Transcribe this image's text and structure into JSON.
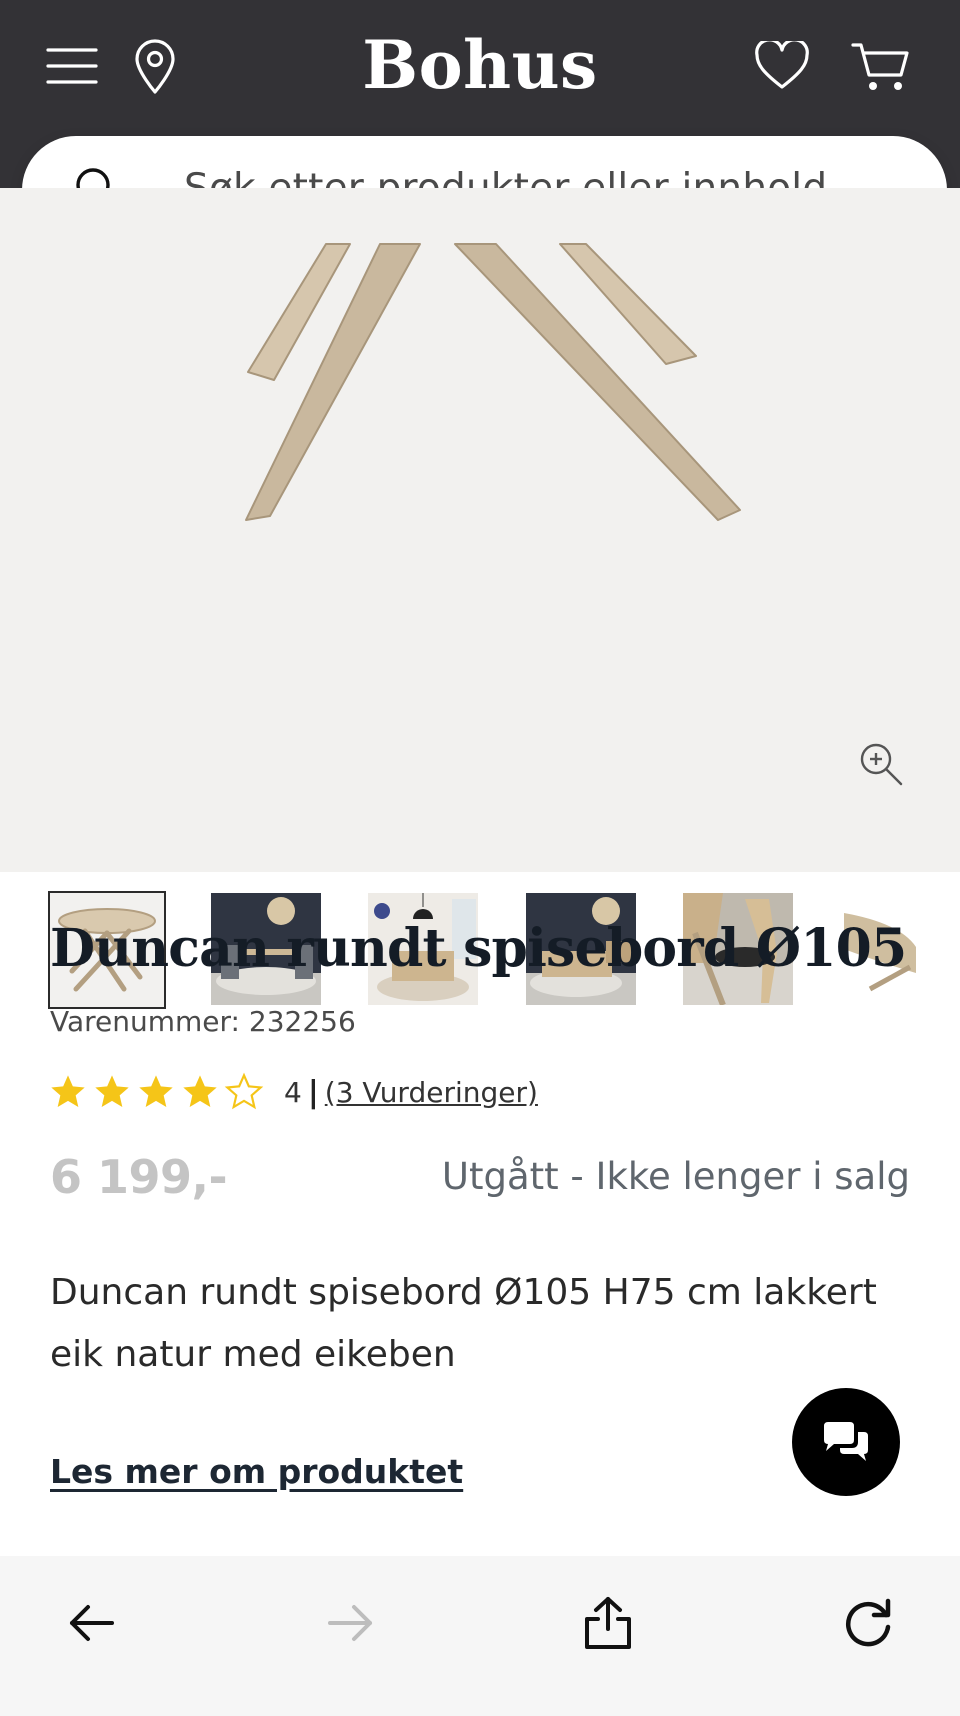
{
  "header": {
    "logo": "Bohus",
    "search_placeholder": "Søk etter produkter eller innhold ..."
  },
  "gallery": {
    "thumbnails": [
      {
        "label": "table-only"
      },
      {
        "label": "dining-room-dark-wall"
      },
      {
        "label": "dining-room-light"
      },
      {
        "label": "dining-room-dark-wall-2"
      },
      {
        "label": "chair-closeup"
      },
      {
        "label": "tabletop-detail"
      }
    ]
  },
  "product": {
    "title": "Duncan rundt spisebord Ø105",
    "sku_text": "Varenummer: 232256",
    "rating": {
      "value": "4",
      "separator": "|",
      "reviews_link": "(3 Vurderinger)",
      "stars_filled": 4,
      "stars_total": 5
    },
    "price": "6 199,-",
    "status": "Utgått - Ikke lenger i salg",
    "description": "Duncan rundt spisebord Ø105 H75 cm lakkert eik natur med eikeben",
    "read_more": "Les mer om produktet"
  },
  "colors": {
    "header_bg": "#333236",
    "gallery_bg": "#f2f1ef",
    "star": "#f5c518",
    "price_disabled": "#c4c4c4"
  }
}
